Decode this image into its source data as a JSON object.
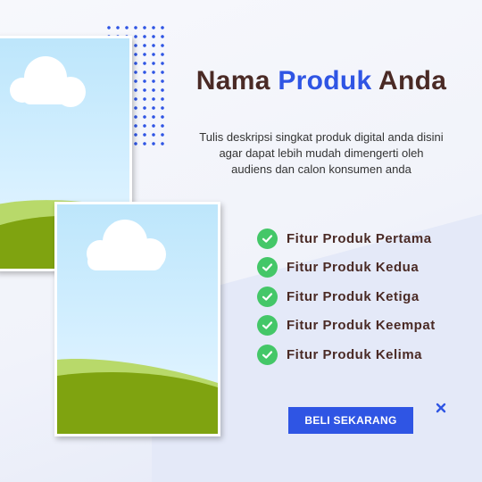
{
  "title": {
    "part1": "Nama ",
    "accent": "Produk",
    "part2": " Anda"
  },
  "description": [
    "Tulis deskripsi singkat produk digital anda disini",
    "agar dapat lebih mudah dimengerti oleh",
    "audiens dan calon konsumen anda"
  ],
  "features": [
    "Fitur Produk Pertama",
    "Fitur Produk Kedua",
    "Fitur Produk Ketiga",
    "Fitur Produk Keempat",
    "Fitur Produk Kelima"
  ],
  "cta": {
    "label": "BELI SEKARANG"
  },
  "colors": {
    "accent": "#2f55e4",
    "heading": "#4a2a25",
    "check": "#44c768",
    "sky": "#bde6fb",
    "grass_light": "#b8d96a",
    "grass_dark": "#7fa310"
  },
  "icons": {
    "feature": "check-circle-icon",
    "decor": "sparkle-cross-icon"
  }
}
